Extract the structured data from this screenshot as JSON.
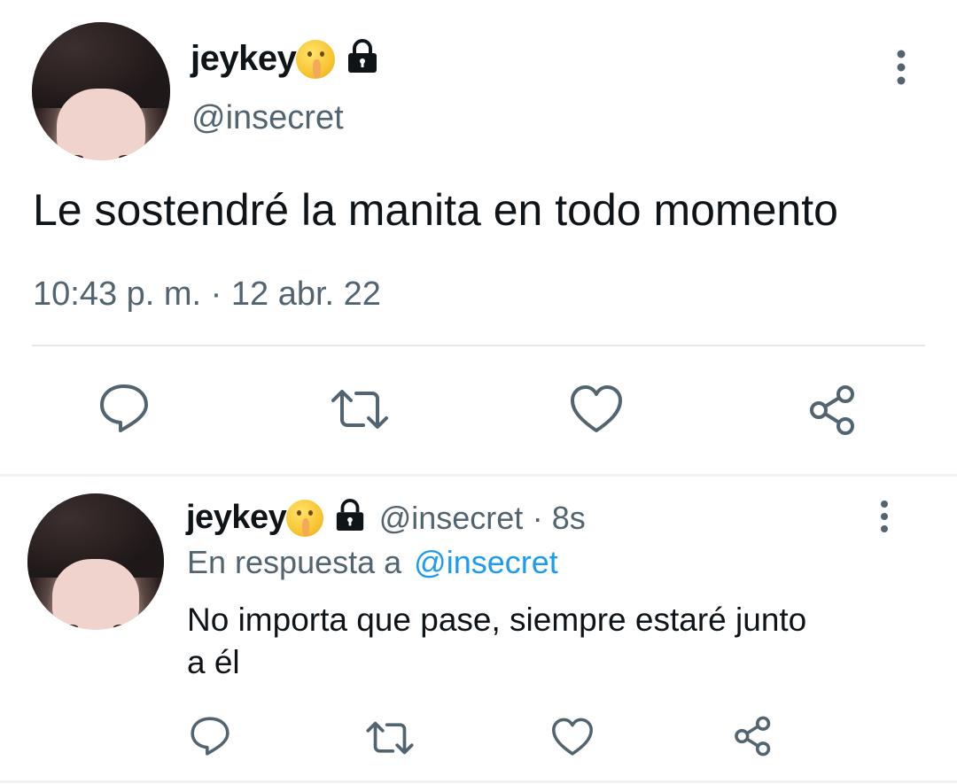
{
  "tweet": {
    "display_name": "jeykey",
    "handle": "@insecret",
    "text": "Le sostendré la manita en todo momento",
    "timestamp": "10:43 p. m. · 12 abr. 22"
  },
  "reply": {
    "display_name": "jeykey",
    "handle": "@insecret",
    "time_sep": "· 8s",
    "replying_to_label": "En respuesta a",
    "replying_to_handle": "@insecret",
    "text_line1": "No importa que pase, siempre estaré junto",
    "text_line2": "a él"
  },
  "colors": {
    "text": "#0f1419",
    "secondary": "#536471",
    "link": "#1d9bf0",
    "divider": "#e1e8ed"
  },
  "icons": [
    "more-vertical-icon",
    "lock-icon",
    "shushing-face-emoji",
    "reply-icon",
    "retweet-icon",
    "like-icon",
    "share-icon"
  ]
}
